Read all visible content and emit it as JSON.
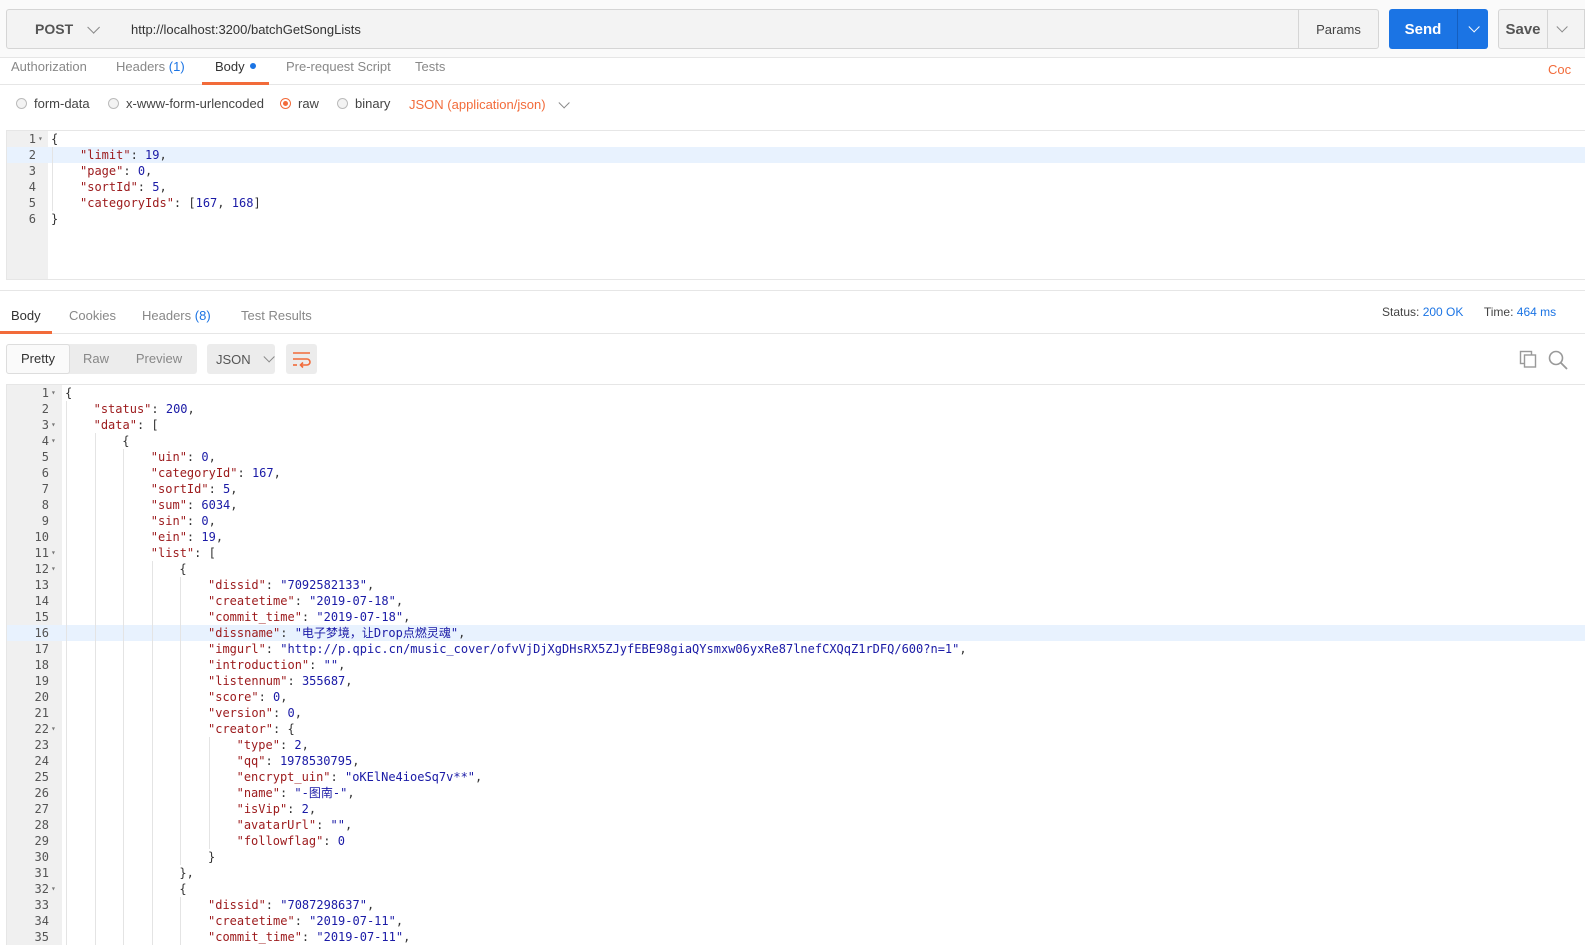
{
  "request": {
    "method": "POST",
    "url": "http://localhost:3200/batchGetSongLists",
    "params_label": "Params",
    "send_label": "Send",
    "save_label": "Save"
  },
  "request_tabs": {
    "authorization": "Authorization",
    "headers": "Headers",
    "headers_count": "(1)",
    "body": "Body",
    "prerequest": "Pre-request Script",
    "tests": "Tests",
    "code_link": "Coc"
  },
  "body_types": {
    "form_data": "form-data",
    "urlencoded": "x-www-form-urlencoded",
    "raw": "raw",
    "binary": "binary",
    "selected": "raw",
    "content_type": "JSON (application/json)"
  },
  "request_body": [
    {
      "n": "1",
      "fold": true,
      "indent": 0,
      "tokens": [
        [
          "p",
          "{"
        ]
      ]
    },
    {
      "n": "2",
      "indent": 1,
      "hl": true,
      "tokens": [
        [
          "k",
          "\"limit\""
        ],
        [
          "p",
          ": "
        ],
        [
          "n",
          "19"
        ],
        [
          "p",
          ","
        ]
      ]
    },
    {
      "n": "3",
      "indent": 1,
      "tokens": [
        [
          "k",
          "\"page\""
        ],
        [
          "p",
          ": "
        ],
        [
          "n",
          "0"
        ],
        [
          "p",
          ","
        ]
      ]
    },
    {
      "n": "4",
      "indent": 1,
      "tokens": [
        [
          "k",
          "\"sortId\""
        ],
        [
          "p",
          ": "
        ],
        [
          "n",
          "5"
        ],
        [
          "p",
          ","
        ]
      ]
    },
    {
      "n": "5",
      "indent": 1,
      "tokens": [
        [
          "k",
          "\"categoryIds\""
        ],
        [
          "p",
          ": ["
        ],
        [
          "n",
          "167"
        ],
        [
          "p",
          ", "
        ],
        [
          "n",
          "168"
        ],
        [
          "p",
          "]"
        ]
      ]
    },
    {
      "n": "6",
      "indent": 0,
      "tokens": [
        [
          "p",
          "}"
        ]
      ]
    }
  ],
  "response_tabs": {
    "body": "Body",
    "cookies": "Cookies",
    "headers": "Headers",
    "headers_count": "(8)",
    "test_results": "Test Results"
  },
  "response_meta": {
    "status_label": "Status:",
    "status_value": "200 OK",
    "time_label": "Time:",
    "time_value": "464 ms"
  },
  "response_view": {
    "pretty": "Pretty",
    "raw": "Raw",
    "preview": "Preview",
    "format": "JSON"
  },
  "response_body": [
    {
      "n": "1",
      "fold": true,
      "indent": 0,
      "tokens": [
        [
          "p",
          "{"
        ]
      ]
    },
    {
      "n": "2",
      "indent": 1,
      "tokens": [
        [
          "k",
          "\"status\""
        ],
        [
          "p",
          ": "
        ],
        [
          "n",
          "200"
        ],
        [
          "p",
          ","
        ]
      ]
    },
    {
      "n": "3",
      "fold": true,
      "indent": 1,
      "tokens": [
        [
          "k",
          "\"data\""
        ],
        [
          "p",
          ": ["
        ]
      ]
    },
    {
      "n": "4",
      "fold": true,
      "indent": 2,
      "tokens": [
        [
          "p",
          "{"
        ]
      ]
    },
    {
      "n": "5",
      "indent": 3,
      "tokens": [
        [
          "k",
          "\"uin\""
        ],
        [
          "p",
          ": "
        ],
        [
          "n",
          "0"
        ],
        [
          "p",
          ","
        ]
      ]
    },
    {
      "n": "6",
      "indent": 3,
      "tokens": [
        [
          "k",
          "\"categoryId\""
        ],
        [
          "p",
          ": "
        ],
        [
          "n",
          "167"
        ],
        [
          "p",
          ","
        ]
      ]
    },
    {
      "n": "7",
      "indent": 3,
      "tokens": [
        [
          "k",
          "\"sortId\""
        ],
        [
          "p",
          ": "
        ],
        [
          "n",
          "5"
        ],
        [
          "p",
          ","
        ]
      ]
    },
    {
      "n": "8",
      "indent": 3,
      "tokens": [
        [
          "k",
          "\"sum\""
        ],
        [
          "p",
          ": "
        ],
        [
          "n",
          "6034"
        ],
        [
          "p",
          ","
        ]
      ]
    },
    {
      "n": "9",
      "indent": 3,
      "tokens": [
        [
          "k",
          "\"sin\""
        ],
        [
          "p",
          ": "
        ],
        [
          "n",
          "0"
        ],
        [
          "p",
          ","
        ]
      ]
    },
    {
      "n": "10",
      "indent": 3,
      "tokens": [
        [
          "k",
          "\"ein\""
        ],
        [
          "p",
          ": "
        ],
        [
          "n",
          "19"
        ],
        [
          "p",
          ","
        ]
      ]
    },
    {
      "n": "11",
      "fold": true,
      "indent": 3,
      "tokens": [
        [
          "k",
          "\"list\""
        ],
        [
          "p",
          ": ["
        ]
      ]
    },
    {
      "n": "12",
      "fold": true,
      "indent": 4,
      "tokens": [
        [
          "p",
          "{"
        ]
      ]
    },
    {
      "n": "13",
      "indent": 5,
      "tokens": [
        [
          "k",
          "\"dissid\""
        ],
        [
          "p",
          ": "
        ],
        [
          "s",
          "\"7092582133\""
        ],
        [
          "p",
          ","
        ]
      ]
    },
    {
      "n": "14",
      "indent": 5,
      "tokens": [
        [
          "k",
          "\"createtime\""
        ],
        [
          "p",
          ": "
        ],
        [
          "s",
          "\"2019-07-18\""
        ],
        [
          "p",
          ","
        ]
      ]
    },
    {
      "n": "15",
      "indent": 5,
      "tokens": [
        [
          "k",
          "\"commit_time\""
        ],
        [
          "p",
          ": "
        ],
        [
          "s",
          "\"2019-07-18\""
        ],
        [
          "p",
          ","
        ]
      ]
    },
    {
      "n": "16",
      "indent": 5,
      "hl": true,
      "tokens": [
        [
          "k",
          "\"dissname\""
        ],
        [
          "p",
          ": "
        ],
        [
          "s",
          "\"电子梦境，让Drop点燃灵魂\""
        ],
        [
          "p",
          ","
        ]
      ]
    },
    {
      "n": "17",
      "indent": 5,
      "tokens": [
        [
          "k",
          "\"imgurl\""
        ],
        [
          "p",
          ": "
        ],
        [
          "s",
          "\"http://p.qpic.cn/music_cover/ofvVjDjXgDHsRX5ZJyfEBE98giaQYsmxw06yxRe87lnefCXQqZ1rDFQ/600?n=1\""
        ],
        [
          "p",
          ","
        ]
      ]
    },
    {
      "n": "18",
      "indent": 5,
      "tokens": [
        [
          "k",
          "\"introduction\""
        ],
        [
          "p",
          ": "
        ],
        [
          "s",
          "\"\""
        ],
        [
          "p",
          ","
        ]
      ]
    },
    {
      "n": "19",
      "indent": 5,
      "tokens": [
        [
          "k",
          "\"listennum\""
        ],
        [
          "p",
          ": "
        ],
        [
          "n",
          "355687"
        ],
        [
          "p",
          ","
        ]
      ]
    },
    {
      "n": "20",
      "indent": 5,
      "tokens": [
        [
          "k",
          "\"score\""
        ],
        [
          "p",
          ": "
        ],
        [
          "n",
          "0"
        ],
        [
          "p",
          ","
        ]
      ]
    },
    {
      "n": "21",
      "indent": 5,
      "tokens": [
        [
          "k",
          "\"version\""
        ],
        [
          "p",
          ": "
        ],
        [
          "n",
          "0"
        ],
        [
          "p",
          ","
        ]
      ]
    },
    {
      "n": "22",
      "fold": true,
      "indent": 5,
      "tokens": [
        [
          "k",
          "\"creator\""
        ],
        [
          "p",
          ": {"
        ]
      ]
    },
    {
      "n": "23",
      "indent": 6,
      "tokens": [
        [
          "k",
          "\"type\""
        ],
        [
          "p",
          ": "
        ],
        [
          "n",
          "2"
        ],
        [
          "p",
          ","
        ]
      ]
    },
    {
      "n": "24",
      "indent": 6,
      "tokens": [
        [
          "k",
          "\"qq\""
        ],
        [
          "p",
          ": "
        ],
        [
          "n",
          "1978530795"
        ],
        [
          "p",
          ","
        ]
      ]
    },
    {
      "n": "25",
      "indent": 6,
      "tokens": [
        [
          "k",
          "\"encrypt_uin\""
        ],
        [
          "p",
          ": "
        ],
        [
          "s",
          "\"oKElNe4ioeSq7v**\""
        ],
        [
          "p",
          ","
        ]
      ]
    },
    {
      "n": "26",
      "indent": 6,
      "tokens": [
        [
          "k",
          "\"name\""
        ],
        [
          "p",
          ": "
        ],
        [
          "s",
          "\"-图南-\""
        ],
        [
          "p",
          ","
        ]
      ]
    },
    {
      "n": "27",
      "indent": 6,
      "tokens": [
        [
          "k",
          "\"isVip\""
        ],
        [
          "p",
          ": "
        ],
        [
          "n",
          "2"
        ],
        [
          "p",
          ","
        ]
      ]
    },
    {
      "n": "28",
      "indent": 6,
      "tokens": [
        [
          "k",
          "\"avatarUrl\""
        ],
        [
          "p",
          ": "
        ],
        [
          "s",
          "\"\""
        ],
        [
          "p",
          ","
        ]
      ]
    },
    {
      "n": "29",
      "indent": 6,
      "tokens": [
        [
          "k",
          "\"followflag\""
        ],
        [
          "p",
          ": "
        ],
        [
          "n",
          "0"
        ]
      ]
    },
    {
      "n": "30",
      "indent": 5,
      "tokens": [
        [
          "p",
          "}"
        ]
      ]
    },
    {
      "n": "31",
      "indent": 4,
      "tokens": [
        [
          "p",
          "},"
        ]
      ]
    },
    {
      "n": "32",
      "fold": true,
      "indent": 4,
      "tokens": [
        [
          "p",
          "{"
        ]
      ]
    },
    {
      "n": "33",
      "indent": 5,
      "tokens": [
        [
          "k",
          "\"dissid\""
        ],
        [
          "p",
          ": "
        ],
        [
          "s",
          "\"7087298637\""
        ],
        [
          "p",
          ","
        ]
      ]
    },
    {
      "n": "34",
      "indent": 5,
      "tokens": [
        [
          "k",
          "\"createtime\""
        ],
        [
          "p",
          ": "
        ],
        [
          "s",
          "\"2019-07-11\""
        ],
        [
          "p",
          ","
        ]
      ]
    },
    {
      "n": "35",
      "indent": 5,
      "tokens": [
        [
          "k",
          "\"commit_time\""
        ],
        [
          "p",
          ": "
        ],
        [
          "s",
          "\"2019-07-11\""
        ],
        [
          "p",
          ","
        ]
      ]
    }
  ],
  "colors": {
    "accent": "#f26b3a",
    "primary": "#1b74e4",
    "json_key": "#9c1a1c",
    "json_value": "#1a1aa6"
  }
}
